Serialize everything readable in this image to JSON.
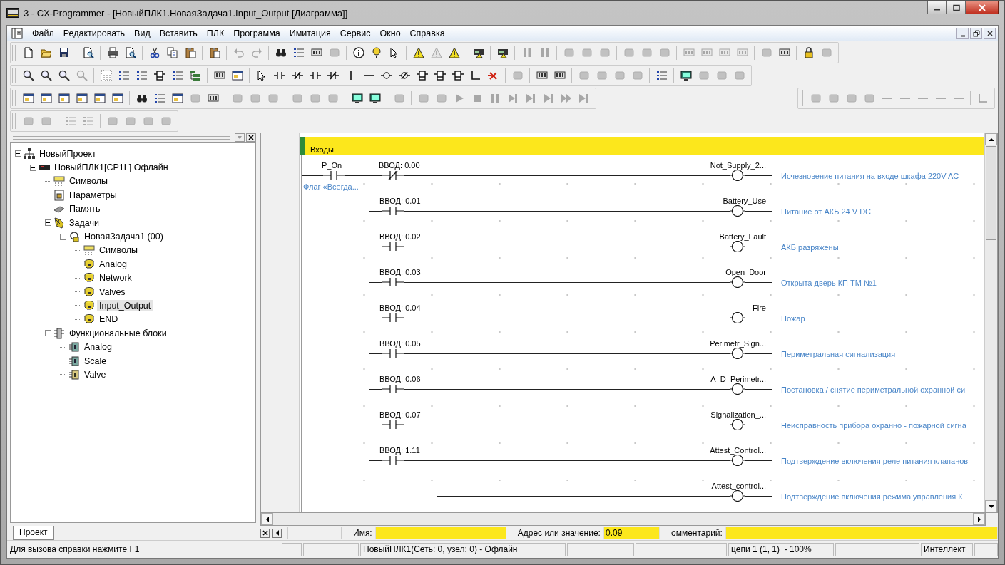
{
  "window": {
    "title": "3 - CX-Programmer - [НовыйПЛК1.НоваяЗадача1.Input_Output [Диаграмма]]"
  },
  "menu": [
    "Файл",
    "Редактировать",
    "Вид",
    "Вставить",
    "ПЛК",
    "Программа",
    "Имитация",
    "Сервис",
    "Окно",
    "Справка"
  ],
  "toolbars": [
    [
      [
        [
          {
            "kind": "new",
            "disabled": false
          },
          {
            "kind": "open",
            "disabled": false
          },
          {
            "kind": "save",
            "disabled": false
          }
        ],
        [
          {
            "kind": "preview",
            "disabled": false
          }
        ],
        [
          {
            "kind": "print",
            "disabled": false
          },
          {
            "kind": "preview",
            "disabled": false
          }
        ],
        [
          {
            "kind": "cut",
            "disabled": false
          },
          {
            "kind": "copy",
            "disabled": false
          },
          {
            "kind": "paste",
            "disabled": false
          }
        ],
        [
          {
            "kind": "paste",
            "disabled": false
          }
        ],
        [
          {
            "kind": "undo",
            "disabled": true
          },
          {
            "kind": "redo",
            "disabled": true
          }
        ],
        [
          {
            "kind": "find",
            "disabled": false
          },
          {
            "kind": "list",
            "disabled": false
          },
          {
            "kind": "rack",
            "disabled": false
          },
          {
            "kind": "generic",
            "disabled": true
          }
        ],
        [
          {
            "kind": "info",
            "disabled": false
          },
          {
            "kind": "help",
            "disabled": false
          },
          {
            "kind": "pointer",
            "disabled": false
          }
        ],
        [
          {
            "kind": "warning",
            "disabled": false
          },
          {
            "kind": "warning",
            "disabled": true
          },
          {
            "kind": "warning",
            "disabled": false
          }
        ],
        [
          {
            "kind": "plc",
            "disabled": false
          }
        ],
        [
          {
            "kind": "plc",
            "disabled": false
          }
        ],
        [
          {
            "kind": "pause",
            "disabled": true
          },
          {
            "kind": "pause",
            "disabled": true
          }
        ],
        [
          {
            "kind": "generic",
            "disabled": true
          },
          {
            "kind": "generic",
            "disabled": true
          },
          {
            "kind": "generic",
            "disabled": true
          }
        ],
        [
          {
            "kind": "generic",
            "disabled": true
          },
          {
            "kind": "generic",
            "disabled": true
          },
          {
            "kind": "generic",
            "disabled": true
          }
        ],
        [
          {
            "kind": "rack",
            "disabled": true
          },
          {
            "kind": "rack",
            "disabled": true
          },
          {
            "kind": "rack",
            "disabled": true
          },
          {
            "kind": "rack",
            "disabled": true
          }
        ],
        [
          {
            "kind": "generic",
            "disabled": true
          },
          {
            "kind": "rack",
            "disabled": false
          }
        ],
        [
          {
            "kind": "lock",
            "disabled": false
          },
          {
            "kind": "generic",
            "disabled": true
          }
        ]
      ]
    ],
    [
      [
        [
          {
            "kind": "zoom",
            "disabled": false
          },
          {
            "kind": "zoom",
            "disabled": false
          },
          {
            "kind": "zoom",
            "disabled": false
          },
          {
            "kind": "zoom",
            "disabled": true
          }
        ],
        [
          {
            "kind": "grid",
            "disabled": false
          },
          {
            "kind": "list",
            "disabled": false
          },
          {
            "kind": "list",
            "disabled": false
          },
          {
            "kind": "instr",
            "disabled": false
          },
          {
            "kind": "list",
            "disabled": false
          },
          {
            "kind": "tree",
            "disabled": false
          }
        ],
        [
          {
            "kind": "rack",
            "disabled": false
          },
          {
            "kind": "window",
            "disabled": false
          }
        ],
        [
          {
            "kind": "pointer",
            "disabled": false
          },
          {
            "kind": "contact",
            "disabled": false
          },
          {
            "kind": "contact-nc",
            "disabled": false
          },
          {
            "kind": "contact",
            "disabled": false
          },
          {
            "kind": "contact-nc",
            "disabled": false
          },
          {
            "kind": "vline",
            "disabled": false
          },
          {
            "kind": "hline",
            "disabled": false
          },
          {
            "kind": "coil",
            "disabled": false
          },
          {
            "kind": "coil-nc",
            "disabled": false
          },
          {
            "kind": "instr",
            "disabled": false
          },
          {
            "kind": "instr",
            "disabled": false
          },
          {
            "kind": "instr",
            "disabled": false
          },
          {
            "kind": "corner",
            "disabled": false
          },
          {
            "kind": "delete",
            "disabled": false
          }
        ],
        [
          {
            "kind": "generic",
            "disabled": true
          }
        ],
        [
          {
            "kind": "rack",
            "disabled": false
          },
          {
            "kind": "rack",
            "disabled": false
          }
        ],
        [
          {
            "kind": "generic",
            "disabled": true
          },
          {
            "kind": "generic",
            "disabled": true
          },
          {
            "kind": "generic",
            "disabled": true
          },
          {
            "kind": "generic",
            "disabled": true
          }
        ],
        [
          {
            "kind": "list",
            "disabled": false
          }
        ],
        [
          {
            "kind": "monitor",
            "disabled": false
          },
          {
            "kind": "generic",
            "disabled": true
          },
          {
            "kind": "generic",
            "disabled": true
          },
          {
            "kind": "generic",
            "disabled": true
          }
        ]
      ]
    ],
    [
      [
        [
          {
            "kind": "window",
            "disabled": false
          },
          {
            "kind": "window",
            "disabled": false
          },
          {
            "kind": "window",
            "disabled": false
          },
          {
            "kind": "window",
            "disabled": false
          },
          {
            "kind": "window",
            "disabled": false
          },
          {
            "kind": "window",
            "disabled": false
          }
        ],
        [
          {
            "kind": "find",
            "disabled": false
          },
          {
            "kind": "list",
            "disabled": false
          },
          {
            "kind": "window",
            "disabled": false
          },
          {
            "kind": "generic",
            "disabled": true
          },
          {
            "kind": "rack",
            "disabled": false
          }
        ],
        [
          {
            "kind": "generic",
            "disabled": true
          },
          {
            "kind": "generic",
            "disabled": true
          },
          {
            "kind": "generic",
            "disabled": true
          }
        ],
        [
          {
            "kind": "generic",
            "disabled": true
          },
          {
            "kind": "generic",
            "disabled": true
          },
          {
            "kind": "generic",
            "disabled": true
          }
        ],
        [
          {
            "kind": "monitor",
            "disabled": false
          },
          {
            "kind": "monitor",
            "disabled": false
          }
        ],
        [
          {
            "kind": "generic",
            "disabled": true
          }
        ],
        [
          {
            "kind": "generic",
            "disabled": true
          },
          {
            "kind": "generic",
            "disabled": true
          },
          {
            "kind": "play",
            "disabled": true
          },
          {
            "kind": "stop",
            "disabled": true
          },
          {
            "kind": "pause",
            "disabled": true
          },
          {
            "kind": "step",
            "disabled": true
          },
          {
            "kind": "step",
            "disabled": true
          },
          {
            "kind": "step",
            "disabled": true
          },
          {
            "kind": "ff",
            "disabled": true
          },
          {
            "kind": "end",
            "disabled": true
          }
        ]
      ],
      [
        [
          {
            "kind": "generic",
            "disabled": true
          },
          {
            "kind": "generic",
            "disabled": true
          },
          {
            "kind": "generic",
            "disabled": true
          },
          {
            "kind": "generic",
            "disabled": true
          },
          {
            "kind": "hline",
            "disabled": true
          },
          {
            "kind": "hline",
            "disabled": true
          },
          {
            "kind": "hline",
            "disabled": true
          },
          {
            "kind": "hline",
            "disabled": true
          },
          {
            "kind": "hline",
            "disabled": true
          }
        ],
        [
          {
            "kind": "corner",
            "disabled": true
          }
        ]
      ]
    ],
    [
      [
        [
          {
            "kind": "generic",
            "disabled": true
          },
          {
            "kind": "generic",
            "disabled": true
          }
        ],
        [
          {
            "kind": "list",
            "disabled": true
          },
          {
            "kind": "list",
            "disabled": true
          }
        ],
        [
          {
            "kind": "generic",
            "disabled": true
          },
          {
            "kind": "generic",
            "disabled": true
          },
          {
            "kind": "generic",
            "disabled": true
          },
          {
            "kind": "generic",
            "disabled": true
          }
        ]
      ]
    ]
  ],
  "tree": [
    {
      "label": "НовыйПроект",
      "kind": "project",
      "expanded": true,
      "selected": false,
      "children": [
        {
          "label": "НовыйПЛК1[CP1L] Офлайн",
          "kind": "plc",
          "expanded": true,
          "selected": false,
          "children": [
            {
              "label": "Символы",
              "kind": "symbols",
              "selected": false
            },
            {
              "label": "Параметры",
              "kind": "settings",
              "selected": false
            },
            {
              "label": "Память",
              "kind": "memory",
              "selected": false
            },
            {
              "label": "Задачи",
              "kind": "tasks",
              "expanded": true,
              "selected": false,
              "children": [
                {
                  "label": "НоваяЗадача1 (00)",
                  "kind": "task",
                  "expanded": true,
                  "selected": false,
                  "children": [
                    {
                      "label": "Символы",
                      "kind": "symbols",
                      "selected": false
                    },
                    {
                      "label": "Analog",
                      "kind": "section",
                      "selected": false
                    },
                    {
                      "label": "Network",
                      "kind": "section",
                      "selected": false
                    },
                    {
                      "label": "Valves",
                      "kind": "section",
                      "selected": false
                    },
                    {
                      "label": "Input_Output",
                      "kind": "section",
                      "selected": true
                    },
                    {
                      "label": "END",
                      "kind": "section",
                      "selected": false
                    }
                  ]
                }
              ]
            },
            {
              "label": "Функциональные блоки",
              "kind": "blocks",
              "expanded": true,
              "selected": false,
              "children": [
                {
                  "label": "Analog",
                  "kind": "fb-s",
                  "selected": false
                },
                {
                  "label": "Scale",
                  "kind": "fb-s",
                  "selected": false
                },
                {
                  "label": "Valve",
                  "kind": "fb-l",
                  "selected": false
                }
              ]
            }
          ]
        }
      ]
    }
  ],
  "project_tab": "Проект",
  "ladder": {
    "heading": "Входы",
    "condition": {
      "symbol": "P_On",
      "comment": "Флаг «Всегда..."
    },
    "rungs": [
      {
        "kind": "contact",
        "address": "ВВОД: 0.00",
        "normally_closed": true,
        "coil": "Not_Supply_2...",
        "comment": "Исчезновение питания на входе шкафа 220V AC"
      },
      {
        "kind": "contact",
        "address": "ВВОД: 0.01",
        "normally_closed": false,
        "coil": "Battery_Use",
        "comment": "Питание от АКБ 24 V DC"
      },
      {
        "kind": "contact",
        "address": "ВВОД: 0.02",
        "normally_closed": false,
        "coil": "Battery_Fault",
        "comment": "АКБ разряжены"
      },
      {
        "kind": "contact",
        "address": "ВВОД: 0.03",
        "normally_closed": false,
        "coil": "Open_Door",
        "comment": "Открыта дверь КП ТМ №1"
      },
      {
        "kind": "contact",
        "address": "ВВОД: 0.04",
        "normally_closed": false,
        "coil": "Fire",
        "comment": "Пожар"
      },
      {
        "kind": "contact",
        "address": "ВВОД: 0.05",
        "normally_closed": false,
        "coil": "Perimetr_Sign...",
        "comment": "Периметральная сигнализация"
      },
      {
        "kind": "contact",
        "address": "ВВОД: 0.06",
        "normally_closed": false,
        "coil": "A_D_Perimetr...",
        "comment": "Постановка / снятие периметральной охранной си"
      },
      {
        "kind": "contact",
        "address": "ВВОД: 0.07",
        "normally_closed": false,
        "coil": "Signalization_...",
        "comment": "Неисправность прибора охранно - пожарной сигна"
      },
      {
        "kind": "contact",
        "address": "ВВОД: 1.11",
        "normally_closed": false,
        "coil": "Attest_Control...",
        "comment": "Подтверждение включения реле питания клапанов"
      },
      {
        "kind": "branch",
        "coil": "Attest_control...",
        "comment": "Подтверждение включения режима управления К"
      }
    ]
  },
  "fields": [
    {
      "label": "Имя:"
    },
    {
      "label": "Адрес или значение:",
      "value": "0.09"
    },
    {
      "label": "омментарий:"
    }
  ],
  "status_bar": {
    "hint": "Для вызова справки нажмите F1",
    "connection": "НовыйПЛК1(Сеть: 0, узел: 0) - Офлайн",
    "position": "цепи 1 (1, 1)  - 100%",
    "mode": "Интеллект"
  }
}
